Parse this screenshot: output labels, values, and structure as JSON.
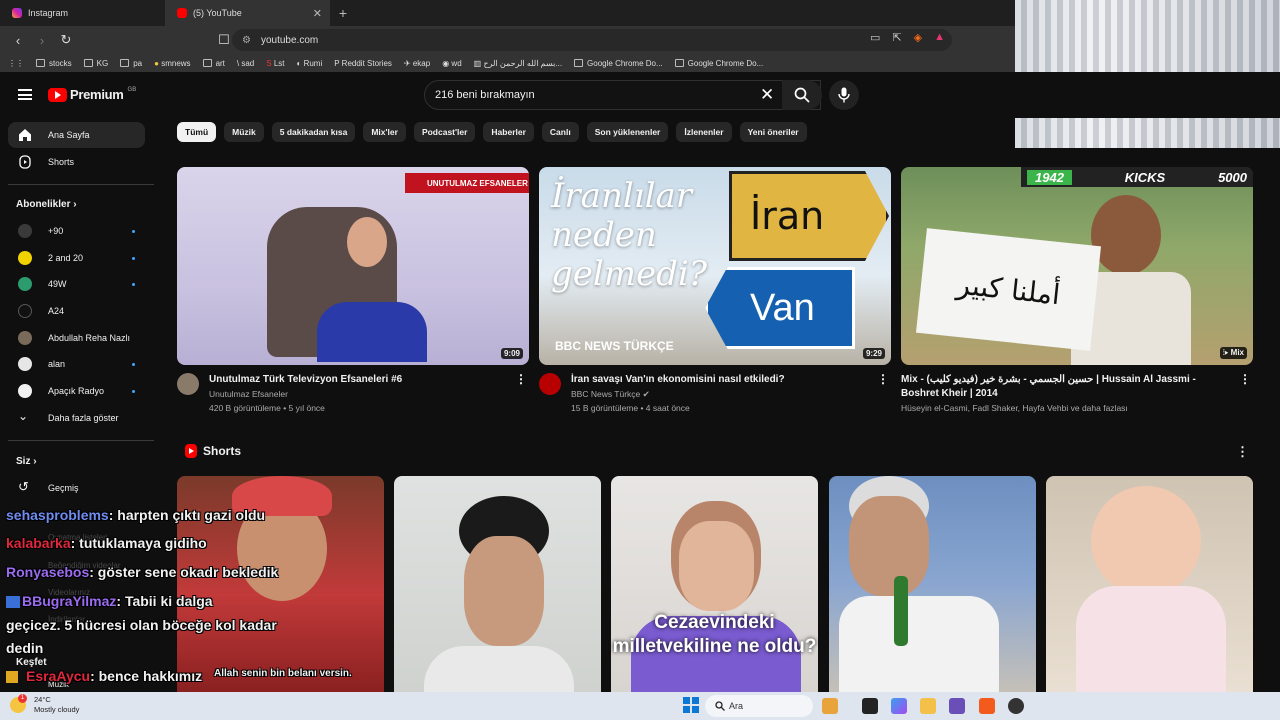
{
  "browser": {
    "tabs": [
      {
        "label": "Instagram",
        "active": false
      },
      {
        "label": "(5) YouTube",
        "active": true
      }
    ],
    "url": "youtube.com",
    "bookmarks": [
      "stocks",
      "KG",
      "pa",
      "smnews",
      "art",
      "sad",
      "Lst",
      "Rumi",
      "Reddit Stories",
      "ekap",
      "wd",
      "بسم الله الرحمن الرح...",
      "Google Chrome Do...",
      "Google Chrome Do..."
    ]
  },
  "youtube": {
    "logo_text": "Premium",
    "region": "GB",
    "search_value": "216 beni bırakmayın",
    "sidebar": {
      "main": [
        {
          "label": "Ana Sayfa",
          "icon": "home-icon",
          "active": true
        },
        {
          "label": "Shorts",
          "icon": "shorts-icon",
          "active": false
        }
      ],
      "subs_header": "Abonelikler",
      "subs": [
        {
          "label": "+90",
          "color": "#3a3a3a",
          "dot": true
        },
        {
          "label": "2 and 20",
          "color": "#f2d200",
          "dot": true
        },
        {
          "label": "49W",
          "color": "#2c9b6d",
          "dot": true
        },
        {
          "label": "A24",
          "color": "#111111",
          "dot": false
        },
        {
          "label": "Abdullah Reha Nazlı",
          "color": "#7a6a5a",
          "dot": false
        },
        {
          "label": "alan",
          "color": "#e6e6e6",
          "dot": true
        },
        {
          "label": "Apaçık Radyo",
          "color": "#f1f1f1",
          "dot": true
        }
      ],
      "more": "Daha fazla göster",
      "you_header": "Siz",
      "you": [
        {
          "label": "Geçmiş",
          "icon": "history-icon"
        }
      ],
      "hidden_labels": [
        "Oynatma listeleri",
        "Beğendiğim videolar",
        "Videolarınız",
        "İndirilenler"
      ],
      "explore_header": "Keşfet",
      "explore_first": "Müzik"
    },
    "chips": [
      "Tümü",
      "Müzik",
      "5 dakikadan kısa",
      "Mix'ler",
      "Podcast'ler",
      "Haberler",
      "Canlı",
      "Son yüklenenler",
      "İzlenenler",
      "Yeni öneriler"
    ],
    "videos": [
      {
        "title": "Unutulmaz Türk Televizyon Efsaneleri #6",
        "channel": "Unutulmaz Efsaneler",
        "meta": "420 B görüntüleme • 5 yıl önce",
        "duration": "9:09",
        "thumb_text": "UNUTULMAZ EFSANELER",
        "verified": false
      },
      {
        "title": "İran savaşı Van'ın ekonomisini nasıl etkiledi?",
        "channel": "BBC News Türkçe",
        "meta": "15 B görüntüleme • 4 saat önce",
        "duration": "9:29",
        "thumb_text": "İranlılar neden gelmedi?",
        "sign1": "İran",
        "sign2": "Van",
        "brand": "BBC NEWS TÜRKÇE",
        "verified": true
      },
      {
        "title": "Mix - (فيديو كليب) حسين الجسمي - بشرة خير | Hussain Al Jassmi - Boshret Kheir | 2014",
        "channel": "Hüseyin el-Casmi, Fadl Shaker, Hayfa Vehbi ve daha fazlası",
        "meta": "",
        "duration": "Mix",
        "thumb_sign": "أملنا كبير",
        "overlay": [
          "1942",
          "KICKS",
          "5000"
        ],
        "verified": false
      }
    ],
    "shorts_title": "Shorts",
    "shorts": [
      {
        "caption": ""
      },
      {
        "caption": ""
      },
      {
        "caption": "Cezaevindeki milletvekiline ne oldu?"
      },
      {
        "caption": ""
      },
      {
        "caption": ""
      }
    ]
  },
  "chat": [
    {
      "user": "sehasproblems",
      "color": "#6f8cf0",
      "text": ": harpten çıktı gazi oldu"
    },
    {
      "user": "kalabarka",
      "color": "#e0283c",
      "text": ": tutuklamaya gidiho"
    },
    {
      "user": "Ronyasebos",
      "color": "#9b6cf2",
      "text": ": göster sene okadr bekledik"
    },
    {
      "user": "BBugraYilmaz",
      "color": "#9b6cf2",
      "text": ": Tabii ki dalga"
    },
    {
      "user": "",
      "color": "#ffffff",
      "text": "geçicez. 5 hücresi olan böceğe kol kadar"
    },
    {
      "user": "",
      "color": "#ffffff",
      "text": "dedin"
    },
    {
      "user": "EsraAycu",
      "color": "#e0283c",
      "text": ": bence hakkımız"
    }
  ],
  "chat_extra": "Allah senin bin belanı versin.",
  "taskbar": {
    "temp": "24°C",
    "weather": "Mostly cloudy",
    "badge": "1",
    "search_placeholder": "Ara"
  }
}
